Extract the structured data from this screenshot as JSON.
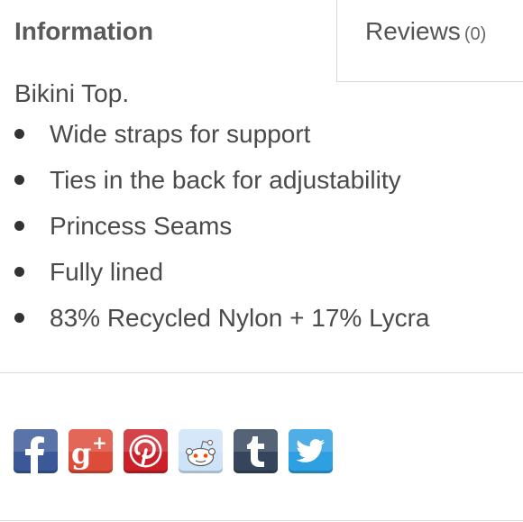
{
  "tabs": {
    "information_label": "Information",
    "reviews_label": "Reviews",
    "reviews_count": "(0)"
  },
  "description": {
    "intro": "Bikini Top.",
    "features": [
      "Wide straps for support",
      "Ties in the back for adjustability",
      "Princess Seams",
      "Fully lined",
      "83% Recycled Nylon + 17% Lycra"
    ]
  },
  "share": {
    "buttons": [
      {
        "icon": "facebook-icon",
        "color": "#3b5998"
      },
      {
        "icon": "google-plus-icon",
        "color": "#dd4b39"
      },
      {
        "icon": "pinterest-icon",
        "color": "#cb2027"
      },
      {
        "icon": "reddit-icon",
        "color": "#cee3f8"
      },
      {
        "icon": "tumblr-icon",
        "color": "#35465c"
      },
      {
        "icon": "twitter-icon",
        "color": "#2e9fe0"
      }
    ]
  }
}
